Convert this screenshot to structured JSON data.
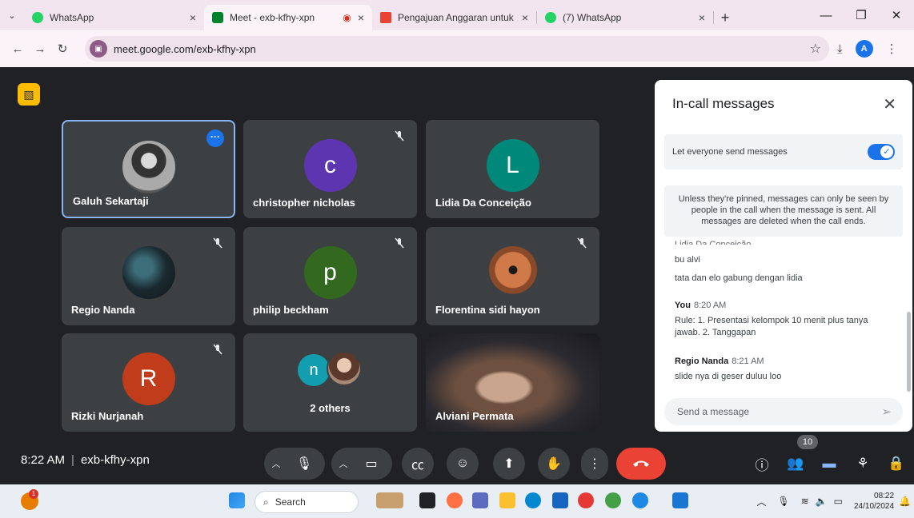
{
  "browser": {
    "tabs": [
      {
        "title": "WhatsApp",
        "color": "#25d366"
      },
      {
        "title": "Meet - exb-kfhy-xpn",
        "color": "#00832d"
      },
      {
        "title": "Pengajuan Anggaran untuk Kon",
        "color": "#ea4335"
      },
      {
        "title": "(7) WhatsApp",
        "color": "#25d366"
      }
    ],
    "url": "meet.google.com/exb-kfhy-xpn"
  },
  "meet": {
    "tiles": [
      {
        "name": "Galuh Sekartaji",
        "initial": "",
        "color": "#6b6b6b",
        "photo": true
      },
      {
        "name": "christopher nicholas",
        "initial": "c",
        "color": "#5e35b1"
      },
      {
        "name": "Lidia Da Conceição",
        "initial": "L",
        "color": "#00897b"
      },
      {
        "name": "Regio Nanda",
        "initial": "",
        "color": "#1b2a30",
        "photo": true
      },
      {
        "name": "philip beckham",
        "initial": "p",
        "color": "#33691e"
      },
      {
        "name": "Florentina sidi hayon",
        "initial": "",
        "color": "#c0613a",
        "photo": true
      },
      {
        "name": "Rizki Nurjanah",
        "initial": "R",
        "color": "#c13c1a"
      },
      {
        "name": "2 others",
        "initial": "n",
        "color": "#129eaf"
      },
      {
        "name": "Alviani Permata",
        "initial": "",
        "color": "#4a3a2a",
        "photo": true
      }
    ],
    "time": "8:22 AM",
    "meeting_code": "exb-kfhy-xpn",
    "people_count": "10"
  },
  "chat": {
    "title": "In-call messages",
    "toggle_label": "Let everyone send messages",
    "info": "Unless they're pinned, messages can only be seen by people in the call when the message is sent. All messages are deleted when the call ends.",
    "messages": [
      {
        "sender": "",
        "time": "",
        "lines": [
          "bu alvi",
          "tata dan elo gabung dengan lidia"
        ]
      },
      {
        "sender": "You",
        "time": "8:20 AM",
        "lines": [
          "Rule: 1. Presentasi kelompok 10 menit plus tanya jawab. 2. Tanggapan"
        ]
      },
      {
        "sender": "Regio Nanda",
        "time": "8:21 AM",
        "lines": [
          "slide nya di geser duluu loo"
        ]
      }
    ],
    "placeholder": "Send a message"
  },
  "taskbar": {
    "search": "Search",
    "time": "08:22",
    "date": "24/10/2024"
  }
}
